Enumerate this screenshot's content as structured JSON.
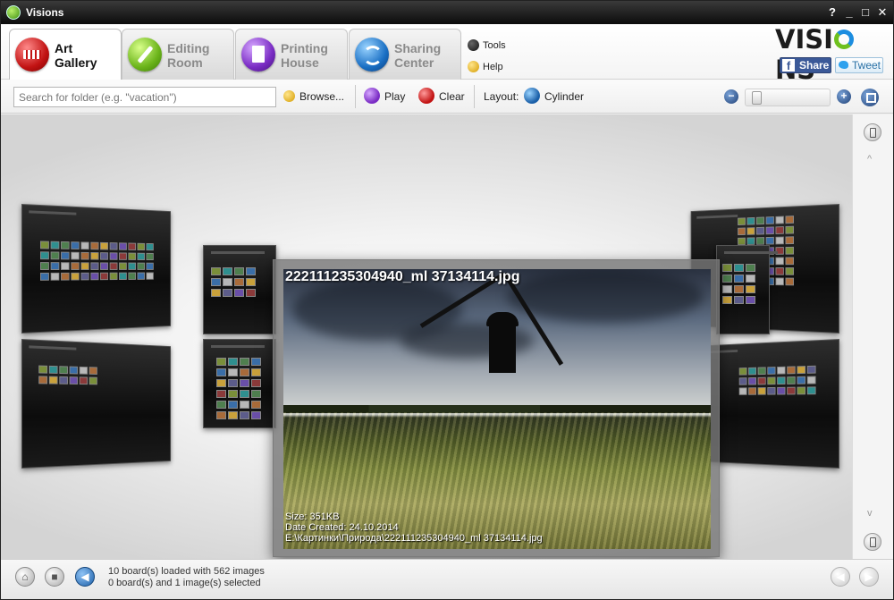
{
  "window": {
    "title": "Visions",
    "controls": [
      "?",
      "_",
      "□",
      "✕"
    ]
  },
  "tabs": [
    {
      "label": "Art\nGallery",
      "active": true
    },
    {
      "label": "Editing\nRoom",
      "active": false
    },
    {
      "label": "Printing\nHouse",
      "active": false
    },
    {
      "label": "Sharing\nCenter",
      "active": false
    }
  ],
  "links": {
    "tools": "Tools",
    "help": "Help"
  },
  "brand": {
    "logo_left": "VISI",
    "logo_right": "NS",
    "share": "Share",
    "tweet": "Tweet",
    "fb_glyph": "f"
  },
  "toolbar": {
    "search_placeholder": "Search for folder (e.g. \"vacation\")",
    "browse": "Browse...",
    "play": "Play",
    "clear": "Clear",
    "layout_label": "Layout:",
    "layout_value": "Cylinder",
    "zoom_out": "−",
    "zoom_in": "+"
  },
  "preview": {
    "filename": "222111235304940_ml 37134114.jpg",
    "size": "Size: 351KB",
    "date": "Date Created: 24.10.2014",
    "path": "E:\\Картинки\\Природа\\222111235304940_ml 37134114.jpg"
  },
  "scroll": {
    "up": "^",
    "down": "v"
  },
  "status": {
    "loaded": "10 board(s) loaded with 562 images",
    "selected": "0 board(s) and 1 image(s) selected"
  },
  "colors": {
    "accent_green": "#6fc11f",
    "accent_blue": "#1c8de0",
    "facebook": "#3b5998"
  }
}
